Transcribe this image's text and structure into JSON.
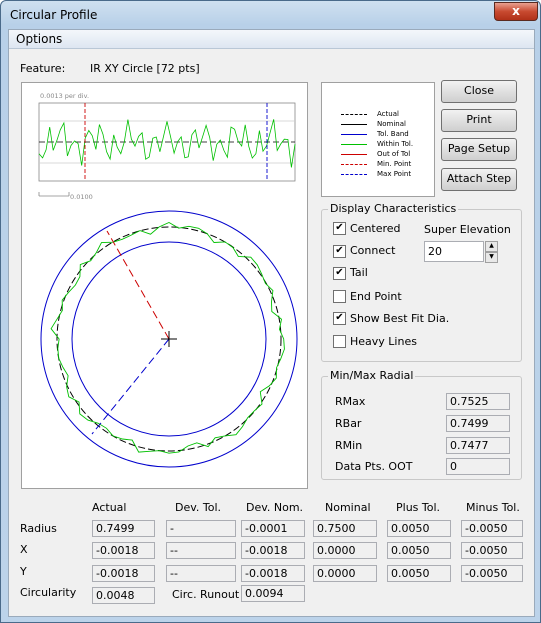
{
  "window": {
    "title": "Circular Profile",
    "close_glyph": "x"
  },
  "menu": {
    "options": "Options"
  },
  "feature": {
    "label": "Feature:",
    "value": "IR XY Circle [72 pts]"
  },
  "deviation_plot": {
    "scale_label": "0.0013 per div.",
    "length_label": "0.0100"
  },
  "legend": [
    {
      "label": "Actual",
      "color": "#000000",
      "style": "dash"
    },
    {
      "label": "Nominal",
      "color": "#000000",
      "style": "solid"
    },
    {
      "label": "Tol. Band",
      "color": "#0000cc",
      "style": "solid"
    },
    {
      "label": "Within Tol.",
      "color": "#00c000",
      "style": "solid"
    },
    {
      "label": "Out of Tol",
      "color": "#cc0000",
      "style": "solid"
    },
    {
      "label": "Min. Point",
      "color": "#cc0000",
      "style": "dash"
    },
    {
      "label": "Max Point",
      "color": "#0000cc",
      "style": "dash"
    }
  ],
  "buttons": {
    "close": "Close",
    "print": "Print",
    "page_setup": "Page Setup",
    "attach_step": "Attach Step"
  },
  "display": {
    "title": "Display Characteristics",
    "centered": {
      "label": "Centered",
      "checked": true
    },
    "connect": {
      "label": "Connect",
      "checked": true
    },
    "tail": {
      "label": "Tail",
      "checked": true
    },
    "end_point": {
      "label": "End Point",
      "checked": false
    },
    "show_best_fit": {
      "label": "Show Best Fit Dia.",
      "checked": true
    },
    "heavy_lines": {
      "label": "Heavy Lines",
      "checked": false
    },
    "super_elevation_label": "Super Elevation",
    "super_elevation_value": "20",
    "check_glyph": "✔"
  },
  "minmax": {
    "title": "Min/Max Radial",
    "rmax_label": "RMax",
    "rmax": "0.7525",
    "rbar_label": "RBar",
    "rbar": "0.7499",
    "rmin_label": "RMin",
    "rmin": "0.7477",
    "oot_label": "Data Pts. OOT",
    "oot": "0"
  },
  "table": {
    "headers": [
      "Actual",
      "Dev. Tol.",
      "Dev. Nom.",
      "Nominal",
      "Plus Tol.",
      "Minus Tol."
    ],
    "rows": [
      {
        "label": "Radius",
        "cells": [
          "0.7499",
          "-",
          "-0.0001",
          "0.7500",
          "0.0050",
          "-0.0050"
        ]
      },
      {
        "label": "X",
        "cells": [
          "-0.0018",
          "--",
          "-0.0018",
          "0.0000",
          "0.0050",
          "-0.0050"
        ]
      },
      {
        "label": "Y",
        "cells": [
          "-0.0018",
          "--",
          "-0.0018",
          "0.0000",
          "0.0050",
          "-0.0050"
        ]
      }
    ],
    "circularity_label": "Circularity",
    "circularity": "0.0048",
    "runout_label": "Circ. Runout",
    "runout": "0.0094"
  }
}
